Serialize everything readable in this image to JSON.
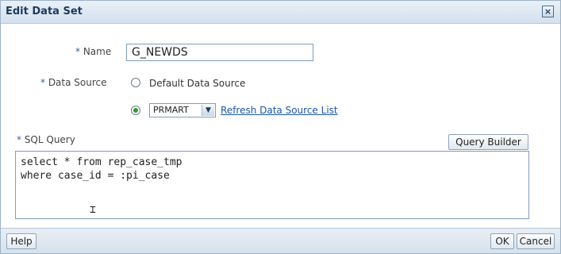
{
  "dialog": {
    "title": "Edit Data Set",
    "close_icon": "close-icon"
  },
  "form": {
    "name_label_req": "*",
    "name_label": " Name",
    "name_value": "G_NEWDS",
    "datasource_label_req": "*",
    "datasource_label": " Data Source",
    "default_ds_label": "Default Data Source",
    "default_ds_checked": false,
    "selected_ds_value": "PRMART",
    "selected_ds_checked": true,
    "refresh_link": "Refresh Data Source List",
    "sql_label_req": "*",
    "sql_label": " SQL Query",
    "query_builder_label": "Query Builder",
    "sql_text": "select * from rep_case_tmp\nwhere case_id = :pi_case"
  },
  "footer": {
    "help_label": "Help",
    "ok_label": "OK",
    "cancel_label": "Cancel"
  },
  "colors": {
    "title_text": "#1d3a5c",
    "link": "#1a55a8",
    "radio_checked": "#2e9b2e"
  }
}
